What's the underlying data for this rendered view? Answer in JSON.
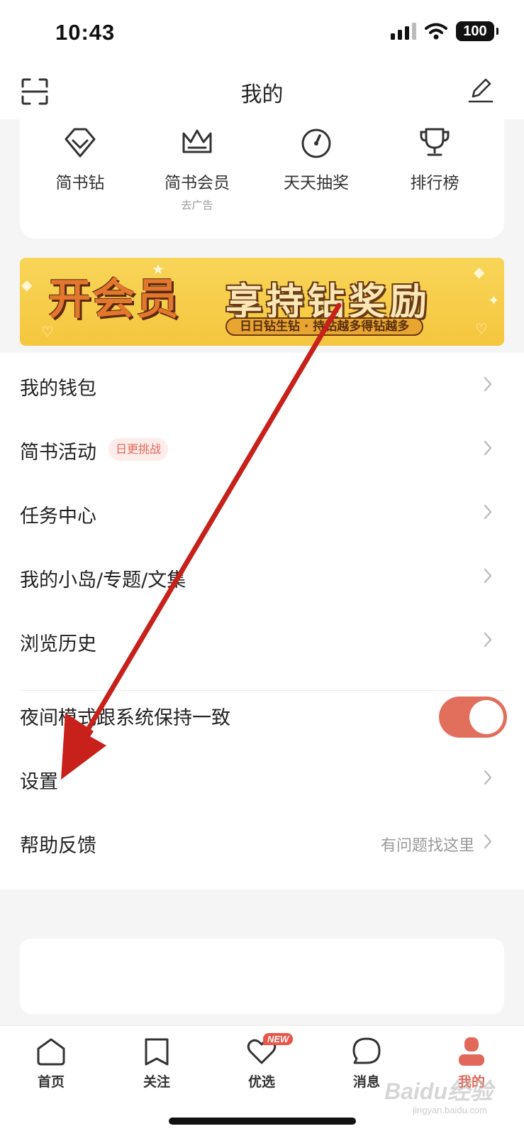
{
  "status_bar": {
    "time": "10:43",
    "battery": "100"
  },
  "nav": {
    "title": "我的"
  },
  "quick": [
    {
      "label": "简书钻",
      "sub": "",
      "icon": "diamond-icon"
    },
    {
      "label": "简书会员",
      "sub": "去广告",
      "icon": "crown-icon"
    },
    {
      "label": "天天抽奖",
      "sub": "",
      "icon": "dial-icon"
    },
    {
      "label": "排行榜",
      "sub": "",
      "icon": "trophy-icon"
    }
  ],
  "banner": {
    "main": "开会员",
    "side": "享持钻奖励",
    "sub": "日日钻生钻 · 持钻越多得钻越多"
  },
  "menu": {
    "wallet": "我的钱包",
    "activity": "简书活动",
    "activity_badge": "日更挑战",
    "tasks": "任务中心",
    "collections": "我的小岛/专题/文集",
    "history": "浏览历史",
    "night_mode": "夜间模式跟系统保持一致",
    "settings": "设置",
    "help": "帮助反馈",
    "help_hint": "有问题找这里"
  },
  "toggle": {
    "on": true,
    "color": "#e26f5c"
  },
  "tabs": [
    {
      "label": "首页",
      "icon": "home-icon",
      "active": false
    },
    {
      "label": "关注",
      "icon": "bookmark-icon",
      "active": false
    },
    {
      "label": "优选",
      "icon": "heart-icon",
      "active": false,
      "badge": "NEW"
    },
    {
      "label": "消息",
      "icon": "chat-bubble-icon",
      "active": false
    },
    {
      "label": "我的",
      "icon": "user-icon",
      "active": true
    }
  ],
  "watermark": {
    "main": "Baidu经验",
    "sub": "jingyan.baidu.com"
  },
  "colors": {
    "accent": "#e2695a",
    "annotation_arrow": "#c8201a"
  }
}
